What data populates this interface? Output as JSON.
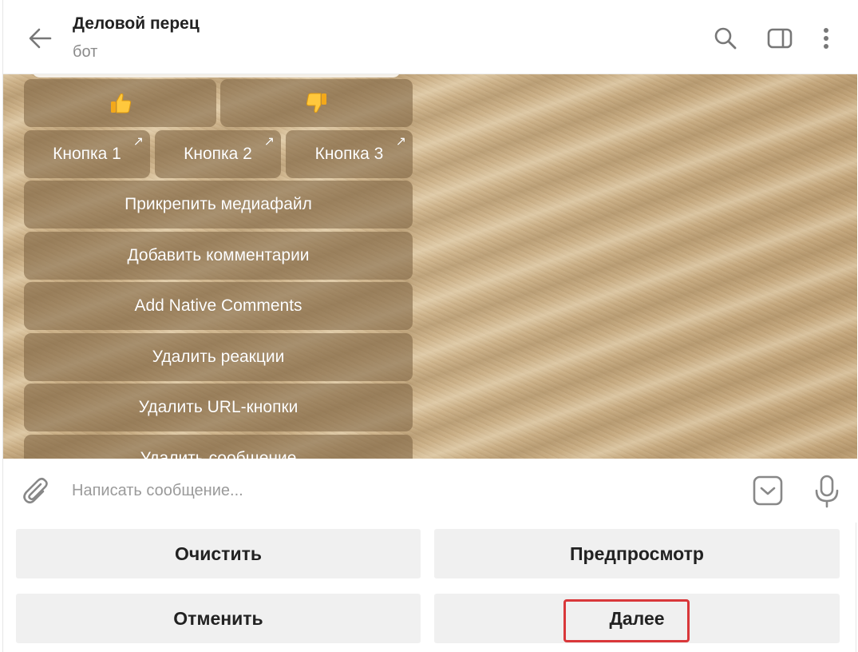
{
  "header": {
    "title": "Деловой перец",
    "subtitle": "бот"
  },
  "keyboard": {
    "reaction_like": "thumbs-up",
    "reaction_dislike": "thumbs-down",
    "url_buttons": [
      "Кнопка 1",
      "Кнопка 2",
      "Кнопка 3"
    ],
    "url_arrow": "↗",
    "actions": [
      "Прикрепить медиафайл",
      "Добавить комментарии",
      "Add Native Comments",
      "Удалить реакции",
      "Удалить URL-кнопки",
      "Удалить сообщение"
    ]
  },
  "input": {
    "placeholder": "Написать сообщение..."
  },
  "reply_keyboard": {
    "clear": "Очистить",
    "preview": "Предпросмотр",
    "cancel": "Отменить",
    "next": "Далее"
  },
  "colors": {
    "accent_strip": "#3aa8c4",
    "highlight": "#d9373a",
    "reply_button_bg": "#f0f0f0"
  }
}
